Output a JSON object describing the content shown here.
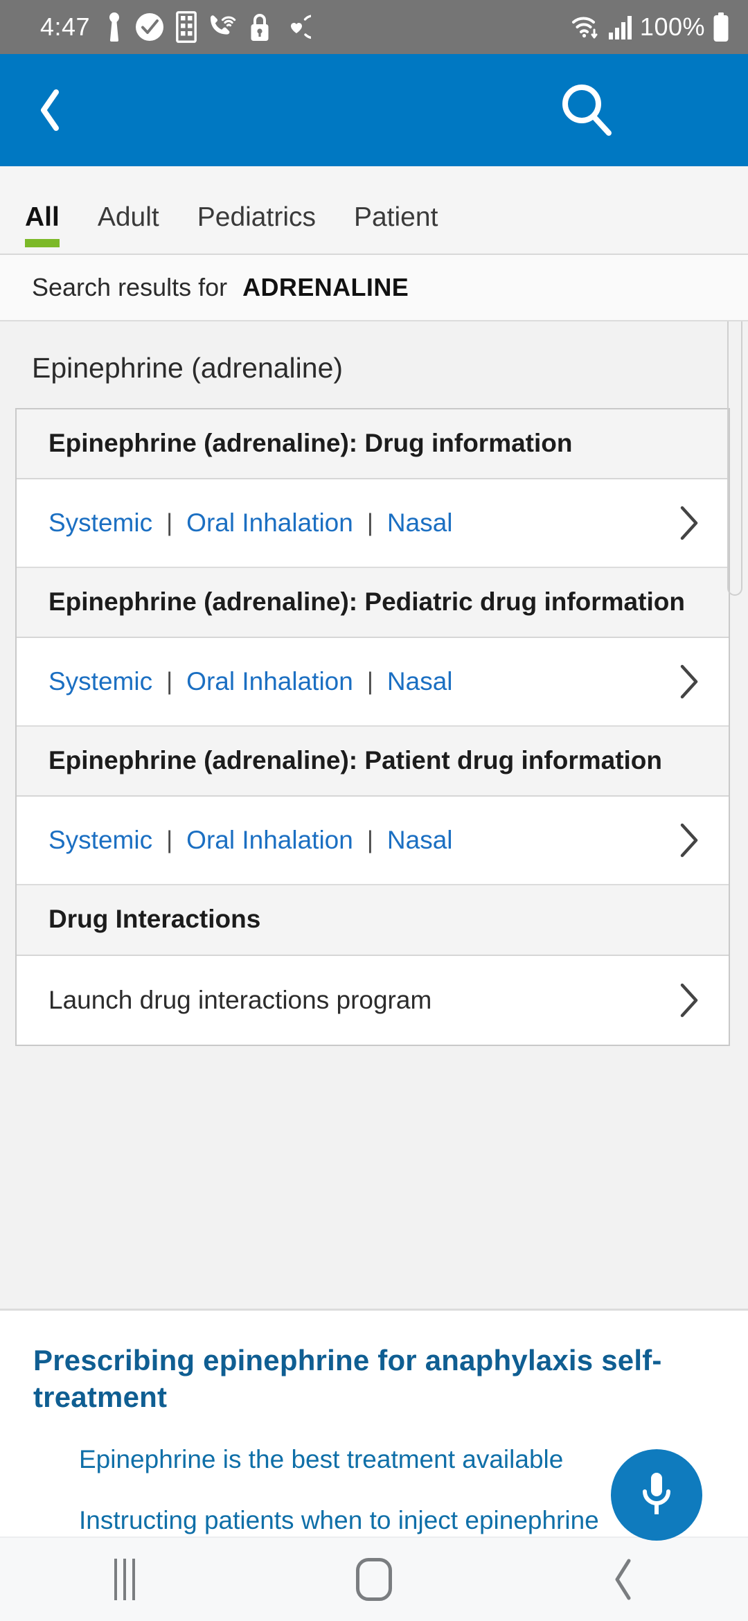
{
  "statusbar": {
    "time": "4:47",
    "battery_percent": "100%",
    "left_icons": [
      "person-icon",
      "check-circle-icon",
      "calculator-icon",
      "phone-wifi-icon",
      "lock-icon",
      "heart-sync-icon"
    ],
    "right_icons": [
      "wifi-icon",
      "signal-bars-icon",
      "battery-icon"
    ]
  },
  "appbar": {
    "back_icon": "chevron-left-icon",
    "search_icon": "search-icon",
    "menu_icon": "hamburger-menu-icon",
    "background_color": "#0078C2"
  },
  "tabs": {
    "items": [
      {
        "label": "All",
        "active": true
      },
      {
        "label": "Adult",
        "active": false
      },
      {
        "label": "Pediatrics",
        "active": false
      },
      {
        "label": "Patient",
        "active": false
      }
    ],
    "indicator_color": "#7CB928"
  },
  "search": {
    "label": "Search results for",
    "query": "ADRENALINE"
  },
  "results": {
    "drug_title": "Epinephrine (adrenaline)",
    "sections": [
      {
        "heading": "Epinephrine (adrenaline): Drug information",
        "row_type": "links",
        "links": [
          "Systemic",
          "Oral Inhalation",
          "Nasal"
        ],
        "separator": "|",
        "chevron": "chevron-right-icon"
      },
      {
        "heading": "Epinephrine (adrenaline): Pediatric drug information",
        "row_type": "links",
        "links": [
          "Systemic",
          "Oral Inhalation",
          "Nasal"
        ],
        "separator": "|",
        "chevron": "chevron-right-icon"
      },
      {
        "heading": "Epinephrine (adrenaline): Patient drug information",
        "row_type": "links",
        "links": [
          "Systemic",
          "Oral Inhalation",
          "Nasal"
        ],
        "separator": "|",
        "chevron": "chevron-right-icon"
      },
      {
        "heading": "Drug Interactions",
        "row_type": "plain",
        "plain_label": "Launch drug interactions program",
        "chevron": "chevron-right-icon"
      }
    ]
  },
  "related": {
    "title": "Prescribing epinephrine for anaphylaxis self-treatment",
    "links": [
      "Epinephrine is the best treatment available",
      "Instructing patients when to inject epinephrine"
    ],
    "link_color": "#0F6FA8",
    "title_color": "#0F5E92"
  },
  "fab": {
    "icon": "microphone-icon",
    "color": "#0F7BBE"
  },
  "navbar": {
    "recents_icon": "recents-icon",
    "home_icon": "home-icon",
    "back_icon": "nav-back-icon"
  }
}
